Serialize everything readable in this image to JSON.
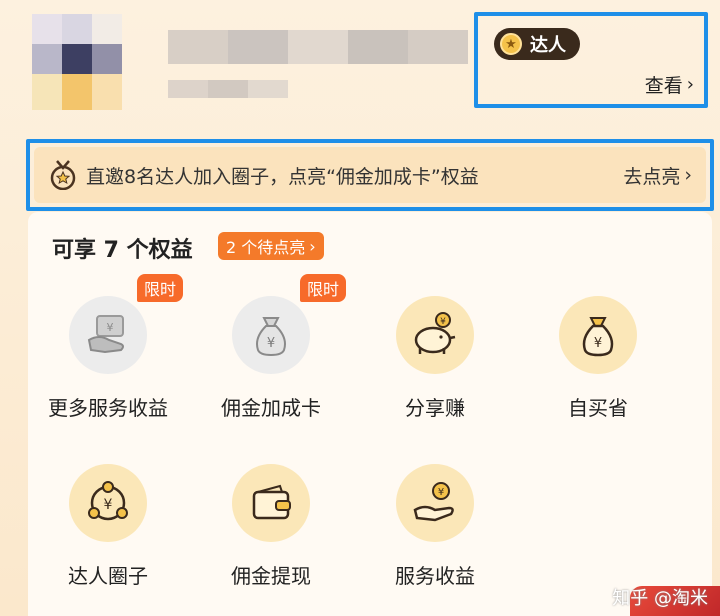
{
  "badge": {
    "title": "达人",
    "link_label": "查看"
  },
  "banner": {
    "text": "直邀8名达人加入圈子，点亮“佣金加成卡”权益",
    "action": "去点亮"
  },
  "benefits_section": {
    "title": "可享 7 个权益",
    "pending_tag": "2 个待点亮",
    "items": [
      {
        "label": "更多服务收益",
        "icon": "hand-card-icon",
        "tag": "限时",
        "state": "locked"
      },
      {
        "label": "佣金加成卡",
        "icon": "money-bag-icon",
        "tag": "限时",
        "state": "locked"
      },
      {
        "label": "分享赚",
        "icon": "piggy-bank-icon",
        "state": "active"
      },
      {
        "label": "自买省",
        "icon": "money-bag-icon",
        "state": "active"
      },
      {
        "label": "达人圈子",
        "icon": "circle-network-icon",
        "state": "active"
      },
      {
        "label": "佣金提现",
        "icon": "wallet-icon",
        "state": "active"
      },
      {
        "label": "服务收益",
        "icon": "coin-hand-icon",
        "state": "active"
      }
    ]
  },
  "watermark": "知乎 @淘米",
  "colors": {
    "highlight_border": "#1e8fe8",
    "accent_orange": "#f47a2a",
    "gold_icon_bg": "#fbe7b8"
  }
}
